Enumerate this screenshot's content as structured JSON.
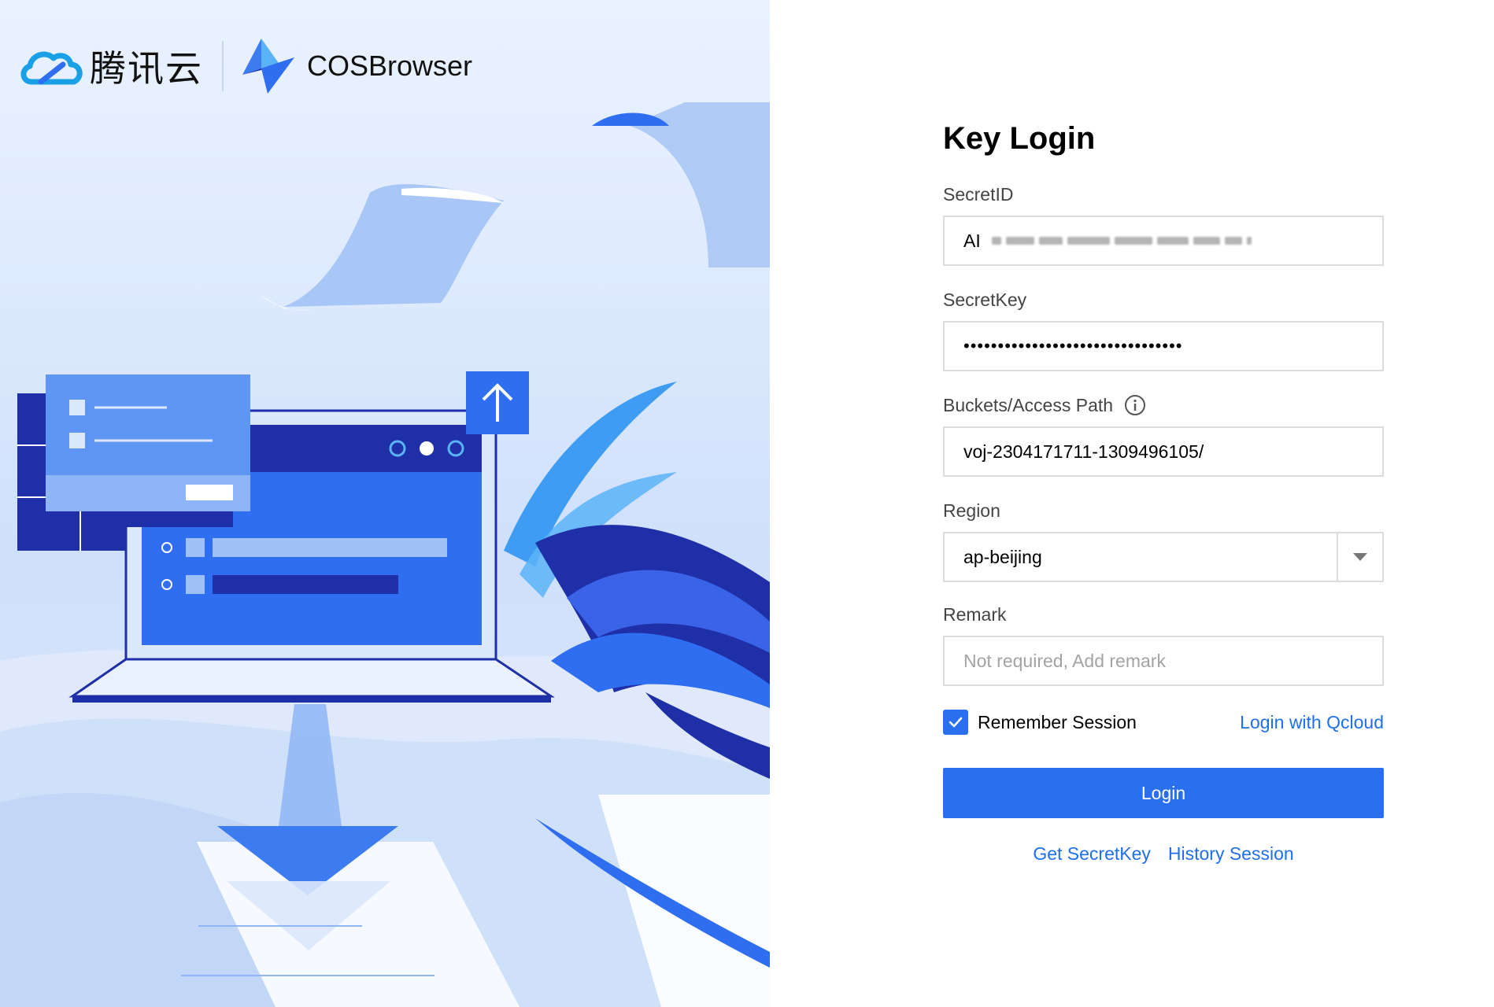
{
  "brand": {
    "cn_name": "腾讯云",
    "app_name": "COSBrowser"
  },
  "form": {
    "title": "Key Login",
    "secret_id": {
      "label": "SecretID",
      "value_prefix": "AI"
    },
    "secret_key": {
      "label": "SecretKey",
      "masked_value": "••••••••••••••••••••••••••••••••"
    },
    "bucket_path": {
      "label": "Buckets/Access Path",
      "value": "voj-2304171711-1309496105/"
    },
    "region": {
      "label": "Region",
      "value": "ap-beijing"
    },
    "remark": {
      "label": "Remark",
      "placeholder": "Not required, Add remark"
    },
    "remember": {
      "label": "Remember Session",
      "checked": true
    },
    "login_qcloud_link": "Login with Qcloud",
    "login_button": "Login",
    "get_secretkey_link": "Get SecretKey",
    "history_session_link": "History Session"
  },
  "colors": {
    "primary": "#2a70ee",
    "link": "#1e6ff0",
    "illustration_dark": "#1f2fa8",
    "illustration_mid": "#2f6ef0",
    "illustration_light": "#9ec0f6"
  },
  "icons": {
    "brand_logo": "tencent-cloud-icon",
    "app_logo": "cos-browser-icon",
    "info": "info-icon",
    "dropdown": "chevron-down-icon",
    "check": "check-icon"
  }
}
